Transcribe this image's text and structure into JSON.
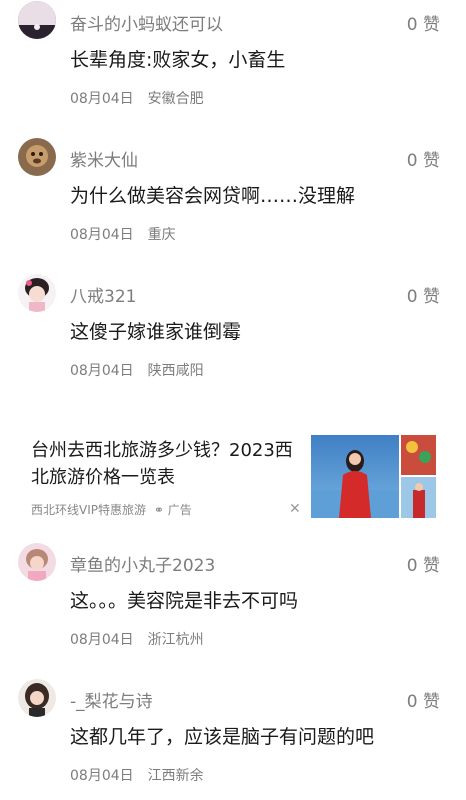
{
  "comments": [
    {
      "username": "奋斗的小蚂蚁还可以",
      "likes": "0 赞",
      "text": "长辈角度:败家女，小畜生",
      "date": "08月04日",
      "location": "安徽合肥"
    },
    {
      "username": "紫米大仙",
      "likes": "0 赞",
      "text": "为什么做美容会网贷啊……没理解",
      "date": "08月04日",
      "location": "重庆"
    },
    {
      "username": "八戒321",
      "likes": "0 赞",
      "text": "这傻子嫁谁家谁倒霉",
      "date": "08月04日",
      "location": "陕西咸阳"
    },
    {
      "username": "章鱼的小丸子2023",
      "likes": "0 赞",
      "text": "这。。。美容院是非去不可吗",
      "date": "08月04日",
      "location": "浙江杭州"
    },
    {
      "username": "-_梨花与诗",
      "likes": "0 赞",
      "text": "这都几年了，应该是脑子有问题的吧",
      "date": "08月04日",
      "location": "江西新余"
    }
  ],
  "ad": {
    "title": "台州去西北旅游多少钱？2023西北旅游价格一览表",
    "source": "西北环线VIP特惠旅游",
    "ad_label": "广告",
    "close_icon": "close-icon"
  }
}
